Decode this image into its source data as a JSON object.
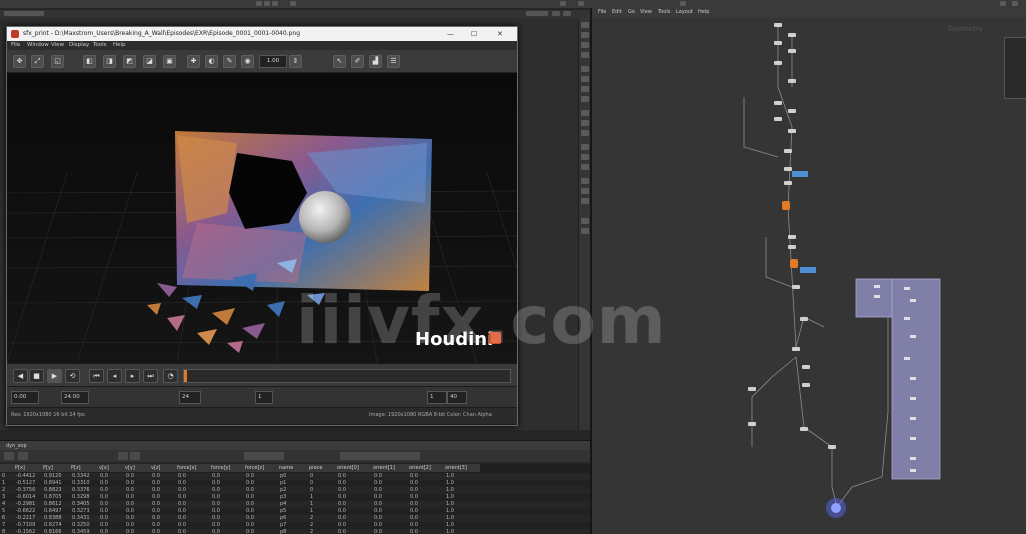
{
  "mplay": {
    "title": "sfx_print - D:\\Maxstrom_Users\\Breaking_A_Wall\\Episodes\\EXR\\Episode_0001_0001-0040.png",
    "minimize": "—",
    "maximize": "☐",
    "close": "✕",
    "menu": [
      "File",
      "Window",
      "View",
      "Display",
      "Tools",
      "Help"
    ],
    "zoom_value": "1.00",
    "watermark_brand": "Houdini",
    "transport": {
      "frame_start": "1",
      "frame_end": "40",
      "start_field": "0.00",
      "end_field": "24.00",
      "fps_field": "24",
      "step_field": "1"
    },
    "status_left": "Res: 1920x1080  16 bit  24 fps",
    "status_right": "Image: 1920x1080  RGBA 8-bit  Color: Chan Alpha"
  },
  "network": {
    "menu": [
      "File",
      "Edit",
      "Go",
      "View",
      "Tools",
      "Layout",
      "Help"
    ],
    "context_label": "Geometry"
  },
  "spreadsheet": {
    "tab_label": "dyn_sop",
    "columns": [
      "",
      "P[x]",
      "P[y]",
      "P[z]",
      "v[x]",
      "v[y]",
      "v[z]",
      "force[x]",
      "force[y]",
      "force[z]",
      "name",
      "piece",
      "orient[0]",
      "orient[1]",
      "orient[2]",
      "orient[3]"
    ],
    "rows": [
      [
        "0",
        "-0.4412",
        "0.9120",
        "0.3342",
        "0.0",
        "0.0",
        "0.0",
        "0.0",
        "0.0",
        "0.0",
        "p0",
        "0",
        "0.0",
        "0.0",
        "0.0",
        "1.0"
      ],
      [
        "1",
        "-0.5127",
        "0.8941",
        "0.3310",
        "0.0",
        "0.0",
        "0.0",
        "0.0",
        "0.0",
        "0.0",
        "p1",
        "0",
        "0.0",
        "0.0",
        "0.0",
        "1.0"
      ],
      [
        "2",
        "-0.3756",
        "0.8823",
        "0.3376",
        "0.0",
        "0.0",
        "0.0",
        "0.0",
        "0.0",
        "0.0",
        "p2",
        "0",
        "0.0",
        "0.0",
        "0.0",
        "1.0"
      ],
      [
        "3",
        "-0.6014",
        "0.8705",
        "0.3298",
        "0.0",
        "0.0",
        "0.0",
        "0.0",
        "0.0",
        "0.0",
        "p3",
        "1",
        "0.0",
        "0.0",
        "0.0",
        "1.0"
      ],
      [
        "4",
        "-0.2981",
        "0.8612",
        "0.3405",
        "0.0",
        "0.0",
        "0.0",
        "0.0",
        "0.0",
        "0.0",
        "p4",
        "1",
        "0.0",
        "0.0",
        "0.0",
        "1.0"
      ],
      [
        "5",
        "-0.6622",
        "0.8497",
        "0.3273",
        "0.0",
        "0.0",
        "0.0",
        "0.0",
        "0.0",
        "0.0",
        "p5",
        "1",
        "0.0",
        "0.0",
        "0.0",
        "1.0"
      ],
      [
        "6",
        "-0.2217",
        "0.8388",
        "0.3431",
        "0.0",
        "0.0",
        "0.0",
        "0.0",
        "0.0",
        "0.0",
        "p6",
        "2",
        "0.0",
        "0.0",
        "0.0",
        "1.0"
      ],
      [
        "7",
        "-0.7109",
        "0.8274",
        "0.3250",
        "0.0",
        "0.0",
        "0.0",
        "0.0",
        "0.0",
        "0.0",
        "p7",
        "2",
        "0.0",
        "0.0",
        "0.0",
        "1.0"
      ],
      [
        "8",
        "-0.1562",
        "0.8166",
        "0.3459",
        "0.0",
        "0.0",
        "0.0",
        "0.0",
        "0.0",
        "0.0",
        "p8",
        "2",
        "0.0",
        "0.0",
        "0.0",
        "1.0"
      ]
    ]
  },
  "watermark": "iiivfx.com",
  "colors": {
    "accent_orange": "#e07b24",
    "node_blue": "#4f8fd6",
    "network_box": "#7f7fa8",
    "selected_node": "#5b6cff"
  }
}
